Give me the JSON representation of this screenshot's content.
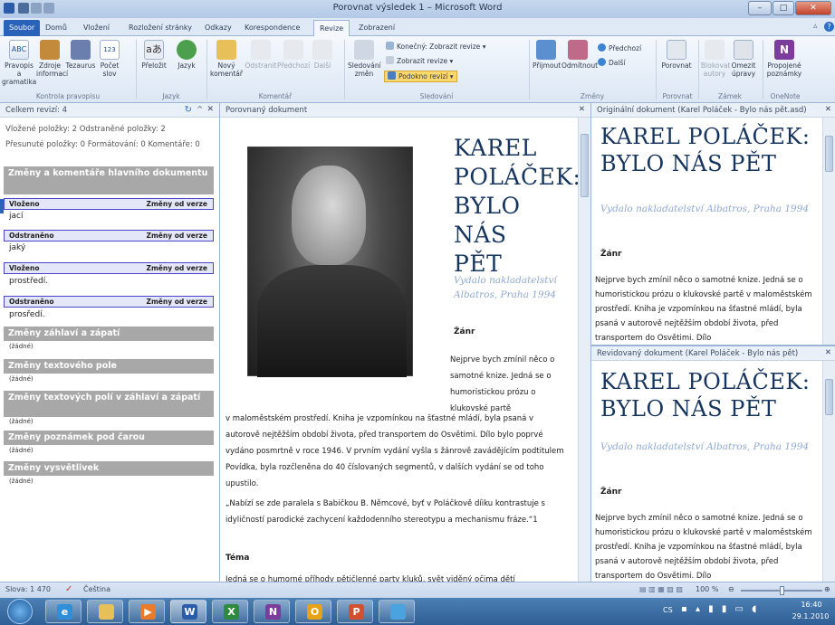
{
  "window": {
    "title": "Porovnat výsledek 1 – Microsoft Word"
  },
  "tabs": [
    "Soubor",
    "Domů",
    "Vložení",
    "Rozložení stránky",
    "Odkazy",
    "Korespondence",
    "Revize",
    "Zobrazení"
  ],
  "ribbon": {
    "proofing": {
      "spell1": "Pravopis a",
      "spell2": "gramatika",
      "research1": "Zdroje",
      "research2": "informací",
      "thesaurus": "Tezaurus",
      "count1": "Počet",
      "count2": "slov",
      "group": "Kontrola pravopisu"
    },
    "language": {
      "translate": "Přeložit",
      "language": "Jazyk",
      "group": "Jazyk"
    },
    "comments": {
      "new1": "Nový",
      "new2": "komentář",
      "delete": "Odstranit",
      "prev": "Předchozí",
      "next": "Další",
      "group": "Komentář"
    },
    "tracking": {
      "track1": "Sledování",
      "track2": "změn",
      "display": "Konečný: Zobrazit revize",
      "show": "Zobrazit revize",
      "pane": "Podokno revizí",
      "group": "Sledování"
    },
    "changes": {
      "accept": "Přijmout",
      "reject": "Odmítnout",
      "previous": "Předchozí",
      "next": "Další",
      "group": "Změny"
    },
    "compare": {
      "compare": "Porovnat",
      "group": "Porovnat"
    },
    "protect": {
      "block1": "Blokovat",
      "block2": "autory",
      "restrict1": "Omezit",
      "restrict2": "úpravy",
      "group": "Zámek"
    },
    "onenote": {
      "linked1": "Propojené",
      "linked2": "poznámky",
      "group": "OneNote"
    }
  },
  "revpane": {
    "header": "Celkem revizí: 4",
    "summary1": "Vložené položky: 2  Odstraněné položky: 2",
    "summary2": "Přesunuté položky: 0  Formátování: 0  Komentáře: 0",
    "main_section": "Změny a komentáře hlavního dokumentu",
    "revisions": [
      {
        "type": "Vloženo",
        "source": "Změny od verze",
        "text": "jací"
      },
      {
        "type": "Odstraněno",
        "source": "Změny od verze",
        "text": "jaký"
      },
      {
        "type": "Vloženo",
        "source": "Změny od verze",
        "text": "prostředí."
      },
      {
        "type": "Odstraněno",
        "source": "Změny od verze",
        "text": "prosředí."
      }
    ],
    "sections": [
      {
        "title": "Změny záhlaví a zápatí",
        "none": "(žádné)"
      },
      {
        "title": "Změny textového pole",
        "none": "(žádné)"
      },
      {
        "title": "Změny textových polí v záhlaví a zápatí",
        "none": "(žádné)"
      },
      {
        "title": "Změny poznámek pod čarou",
        "none": "(žádné)"
      },
      {
        "title": "Změny vysvětlivek",
        "none": "(žádné)"
      }
    ]
  },
  "compared": {
    "header": "Porovnaný dokument",
    "title": "KAREL POLÁČEK: BYLO NÁS PĚT",
    "subtitle": "Vydalo nakladatelství Albatros, Praha 1994",
    "genre": "Žánr",
    "p1a": "Nejprve bych zmínil něco o samotné knize. Jedná se o humoristickou prózu o klukovské partě",
    "p1b": "v maloměstském prostředí. Kniha je vzpomínkou na šťastné mládí, byla psaná v autorově nejtěžším období života, před transportem do Osvětimi. Dílo bylo poprvé vydáno posmrtně v roce 1946. V prvním vydání vyšla s žánrově zavádějícím podtitulem Povídka, byla rozčleněna do 40 číslovaných segmentů, v dalších vydání se od toho upustilo.",
    "p2": "„Nabízí se zde paralela s Babičkou B. Němcové, byť v Poláčkově díiku kontrastuje s idyličností parodické zachycení každodenního stereotypu a mechanismu fráze.“1",
    "theme": "Téma",
    "p3": "Jedná se o humorné příhody pětičlenné party kluků, svět viděný očima dětí"
  },
  "original": {
    "header": "Originální dokument (Karel Poláček - Bylo nás pět.asd)",
    "title": "KAREL POLÁČEK: BYLO NÁS PĚT",
    "subtitle": "Vydalo nakladatelství Albatros, Praha 1994",
    "genre": "Žánr",
    "p1": "Nejprve bych zmínil něco o samotné knize. Jedná se o humoristickou prózu o klukovské partě v maloměstském prostředí. Kniha je vzpomínkou na šťastné mládí, byla psaná v autorově nejtěžším období života, před transportem do Osvětimi. Dílo"
  },
  "revised": {
    "header": "Revidovaný dokument (Karel Poláček - Bylo nás pět)",
    "title": "KAREL POLÁČEK: BYLO NÁS PĚT",
    "subtitle": "Vydalo nakladatelství Albatros, Praha 1994",
    "genre": "Žánr",
    "p1": "Nejprve bych zmínil něco o samotné knize. Jedná se o humoristickou prózu o klukovské partě v maloměstském prostředí. Kniha je vzpomínkou na šťastné mládí, byla psaná v autorově nejtěžším období života, před transportem do Osvětimi. Dílo"
  },
  "status": {
    "words": "Slova: 1 470",
    "language": "Čeština",
    "zoom": "100 %"
  },
  "taskbar": {
    "lang": "CS",
    "time": "16:40",
    "date": "29.1.2010"
  }
}
